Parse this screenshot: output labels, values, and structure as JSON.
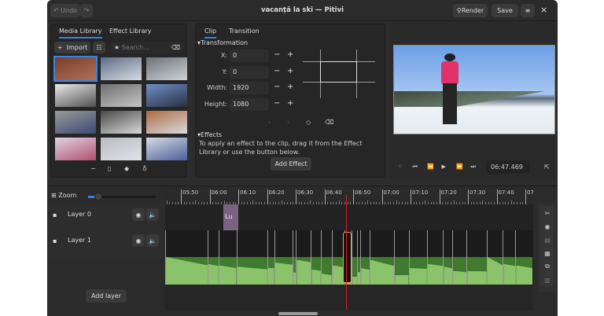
{
  "header": {
    "undo": "Undo",
    "redo_icon": "redo-icon",
    "title": "vacanță la ski — Pitivi",
    "render": "Render",
    "save": "Save",
    "menu_icon": "hamburger-menu-icon",
    "close": "×"
  },
  "library": {
    "tabs": [
      "Media Library",
      "Effect Library"
    ],
    "import": "Import",
    "search_placeholder": "Search...",
    "thumb_count": 12,
    "bottom_icons": [
      "remove-icon",
      "clip-properties-icon",
      "tag-icon",
      "proxy-icon"
    ]
  },
  "clip": {
    "tabs": [
      "Clip",
      "Transition"
    ],
    "transformation": "Transformation",
    "fields": [
      {
        "label": "X:",
        "value": "0"
      },
      {
        "label": "Y:",
        "value": "0"
      },
      {
        "label": "Width:",
        "value": "1920"
      },
      {
        "label": "Height:",
        "value": "1080"
      }
    ],
    "effects": "Effects",
    "effects_help": "To apply an effect to the clip, drag it from the Effect Library or use the button below.",
    "add_effect": "Add Effect"
  },
  "viewer": {
    "timecode": "06:47.469"
  },
  "timeline": {
    "zoom": "Zoom",
    "zoom_level": 0.15,
    "ticks": [
      "05:50",
      "06:00",
      "06:10",
      "06:20",
      "06:30",
      "06:40",
      "06:50",
      "07:00",
      "07:10",
      "07:20",
      "07:30",
      "07:40",
      "07:"
    ],
    "playhead": "06:47.469",
    "layers": [
      {
        "name": "Layer 0"
      },
      {
        "name": "Layer 1"
      }
    ],
    "title_clip": "Lu",
    "add_layer": "Add layer"
  },
  "colors": {
    "accent": "#3584e4",
    "playhead": "#e01b24",
    "audio_dark": "#3f7a2e",
    "audio_light": "#8bc36a",
    "title_clip": "#7a6382"
  }
}
